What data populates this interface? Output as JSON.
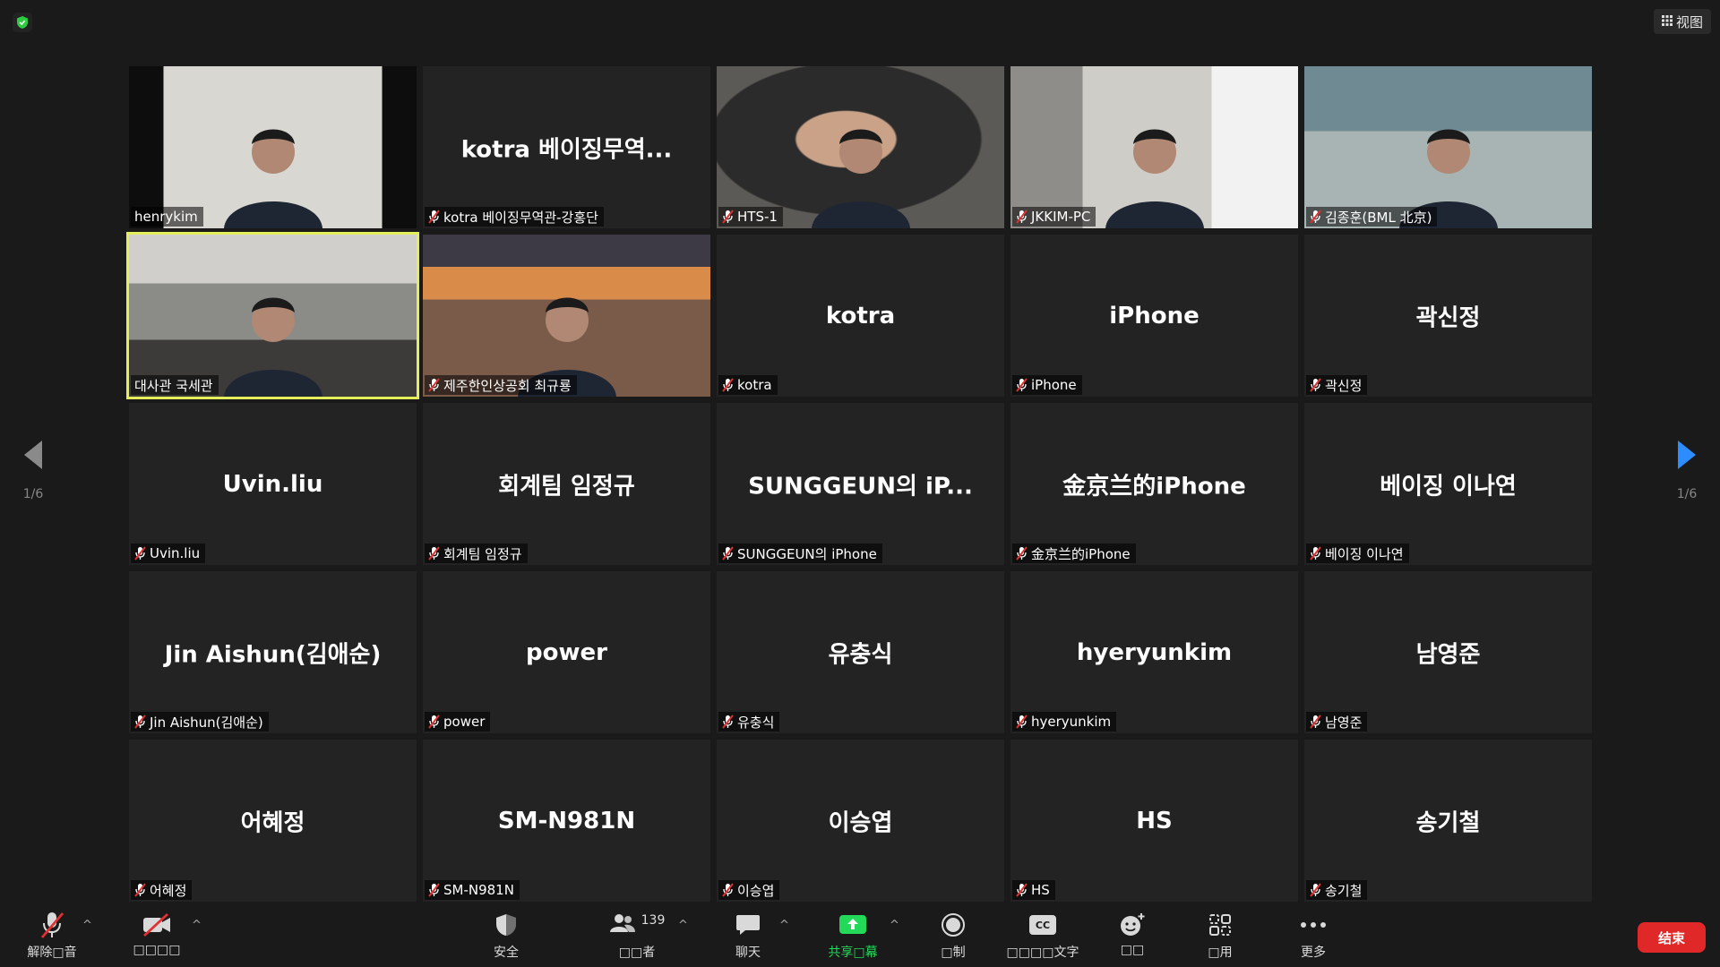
{
  "top_bar": {
    "view_label": "视图"
  },
  "paging": {
    "left_page": "1/6",
    "right_page": "1/6"
  },
  "tiles": [
    {
      "id": "henrykim",
      "label": "henrykim",
      "big": "",
      "video": true,
      "mic_off": false
    },
    {
      "id": "kotra-beijing",
      "label": "kotra 베이징무역관-강홍단",
      "big": "kotra 베이징무역...",
      "video": false,
      "mic_off": true
    },
    {
      "id": "hts-1",
      "label": "HTS-1",
      "big": "",
      "video": true,
      "mic_off": true
    },
    {
      "id": "jkkim-pc",
      "label": "JKKIM-PC",
      "big": "",
      "video": true,
      "mic_off": true
    },
    {
      "id": "kim-bml",
      "label": "김종훈(BML 北京)",
      "big": "",
      "video": true,
      "mic_off": true
    },
    {
      "id": "embassy",
      "label": "대사관 국세관",
      "big": "",
      "video": true,
      "mic_off": false,
      "active": true
    },
    {
      "id": "jeju",
      "label": "제주한인상공회 최규룡",
      "big": "",
      "video": true,
      "mic_off": true
    },
    {
      "id": "kotra",
      "label": "kotra",
      "big": "kotra",
      "video": false,
      "mic_off": true
    },
    {
      "id": "iphone",
      "label": "iPhone",
      "big": "iPhone",
      "video": false,
      "mic_off": true
    },
    {
      "id": "kwak",
      "label": "곽신정",
      "big": "곽신정",
      "video": false,
      "mic_off": true
    },
    {
      "id": "uvin",
      "label": "Uvin.liu",
      "big": "Uvin.liu",
      "video": false,
      "mic_off": true
    },
    {
      "id": "accounting",
      "label": "회계팀 임정규",
      "big": "회계팀 임정규",
      "video": false,
      "mic_off": true
    },
    {
      "id": "sunggeun",
      "label": "SUNGGEUN의 iPhone",
      "big": "SUNGGEUN의 iP...",
      "video": false,
      "mic_off": true
    },
    {
      "id": "jinjinglan",
      "label": "金京兰的iPhone",
      "big": "金京兰的iPhone",
      "video": false,
      "mic_off": true
    },
    {
      "id": "beijing-lee",
      "label": "베이징 이나연",
      "big": "베이징 이나연",
      "video": false,
      "mic_off": true
    },
    {
      "id": "jin-aishun",
      "label": "Jin Aishun(김애순)",
      "big": "Jin  Aishun(김애순)",
      "video": false,
      "mic_off": true
    },
    {
      "id": "power",
      "label": "power",
      "big": "power",
      "video": false,
      "mic_off": true
    },
    {
      "id": "yoo",
      "label": "유충식",
      "big": "유충식",
      "video": false,
      "mic_off": true
    },
    {
      "id": "hyeryun",
      "label": "hyeryunkim",
      "big": "hyeryunkim",
      "video": false,
      "mic_off": true
    },
    {
      "id": "nam",
      "label": "남영준",
      "big": "남영준",
      "video": false,
      "mic_off": true
    },
    {
      "id": "eo",
      "label": "어혜정",
      "big": "어혜정",
      "video": false,
      "mic_off": true
    },
    {
      "id": "sm",
      "label": "SM-N981N",
      "big": "SM-N981N",
      "video": false,
      "mic_off": true
    },
    {
      "id": "lee-sy",
      "label": "이승엽",
      "big": "이승엽",
      "video": false,
      "mic_off": true
    },
    {
      "id": "hs",
      "label": "HS",
      "big": "HS",
      "video": false,
      "mic_off": true
    },
    {
      "id": "song",
      "label": "송기철",
      "big": "송기철",
      "video": false,
      "mic_off": true
    }
  ],
  "toolbar": {
    "unmute_label": "解除□音",
    "video_label": "□□□□",
    "security_label": "安全",
    "participants_label": "□□者",
    "participants_count": "139",
    "chat_label": "聊天",
    "share_label": "共享□幕",
    "record_label": "□制",
    "captions_label": "□□□□文字",
    "reactions_label": "□□",
    "apps_label": "□用",
    "more_label": "更多",
    "end_label": "结束",
    "cc_text": "CC"
  },
  "colors": {
    "active_border": "#e3ee5a",
    "mic_red": "#e0302f",
    "share_green": "#23d959",
    "end_red": "#e02828",
    "nav_arrow_blue": "#2d8cff"
  }
}
